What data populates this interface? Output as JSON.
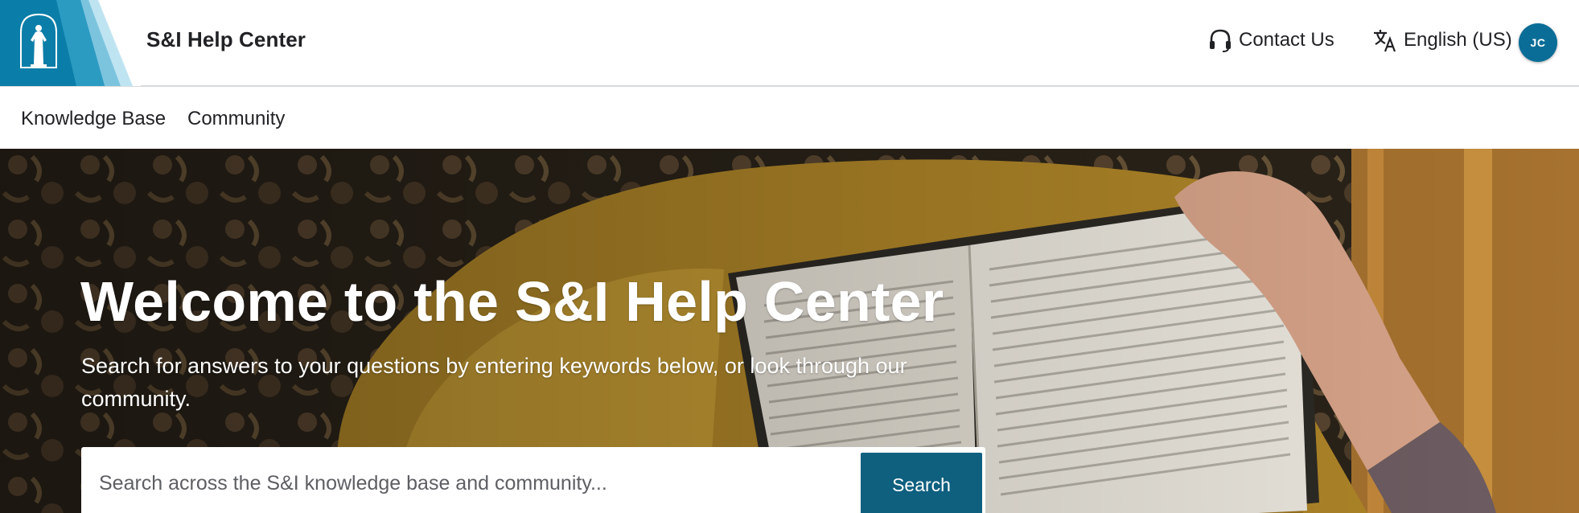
{
  "header": {
    "site_title": "S&I Help Center",
    "contact_label": "Contact Us",
    "language_label": "English (US)",
    "avatar_initials": "JC",
    "logo_icon": "christus-statue-logo",
    "contact_icon": "headset-icon",
    "language_icon": "translate-icon"
  },
  "nav": {
    "items": [
      {
        "label": "Knowledge Base"
      },
      {
        "label": "Community"
      }
    ]
  },
  "hero": {
    "title": "Welcome to the S&I Help Center",
    "subtitle": "Search for answers to your questions by entering keywords below, or look through our community.",
    "search": {
      "placeholder": "Search across the S&I knowledge base and community...",
      "value": "",
      "button_label": "Search"
    }
  },
  "colors": {
    "brand_blue": "#0a7ea8",
    "search_button": "#0f5f7f",
    "avatar": "#0a6d97",
    "text": "#212225"
  }
}
